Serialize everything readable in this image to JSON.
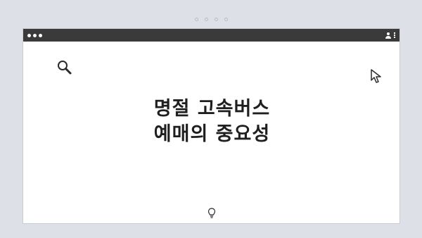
{
  "heading": {
    "line1": "명절 고속버스",
    "line2": "예매의 중요성"
  },
  "icons": {
    "search": "search-icon",
    "cursor": "cursor-icon",
    "bulb": "lightbulb-icon",
    "user": "user-icon",
    "menu": "kebab-menu-icon"
  },
  "colors": {
    "background": "#dde1e7",
    "titlebar": "#3a3a3a",
    "window": "#ffffff",
    "text": "#1f1f1f"
  }
}
